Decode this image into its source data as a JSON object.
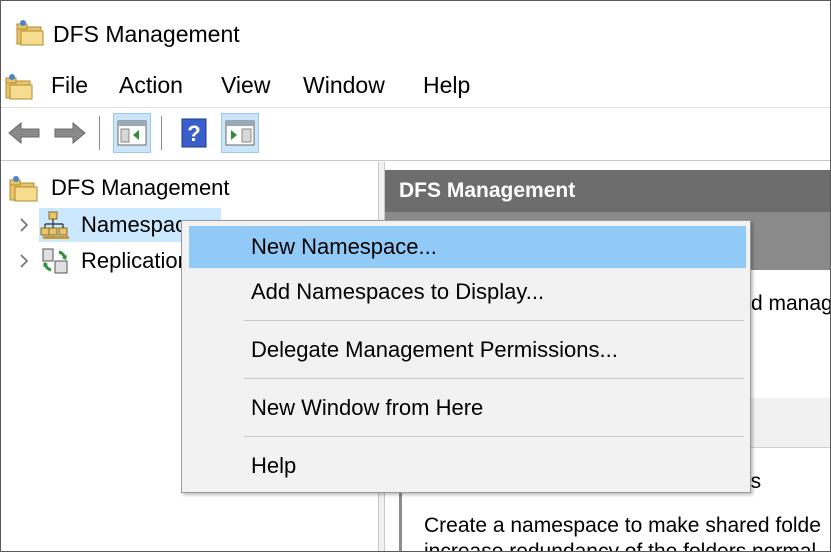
{
  "window": {
    "title": "DFS Management"
  },
  "menubar": {
    "items": [
      "File",
      "Action",
      "View",
      "Window",
      "Help"
    ]
  },
  "toolbar": {
    "buttons": [
      {
        "name": "back",
        "icon": "back-arrow-icon"
      },
      {
        "name": "forward",
        "icon": "forward-arrow-icon"
      },
      {
        "name": "show-hide-console-tree",
        "icon": "console-tree-icon",
        "pressed": true
      },
      {
        "name": "help",
        "icon": "help-icon",
        "label": "?"
      },
      {
        "name": "show-hide-action-pane",
        "icon": "action-pane-icon",
        "pressed": true
      }
    ]
  },
  "tree": {
    "root": {
      "label": "DFS Management",
      "icon": "dfs-management-icon"
    },
    "nodes": [
      {
        "label": "Namespaces",
        "icon": "namespaces-icon",
        "selected": true
      },
      {
        "label": "Replication",
        "icon": "replication-icon",
        "selected": false
      }
    ]
  },
  "right_pane": {
    "header": "DFS Management",
    "description_fragment": "d manag",
    "section_title_fragment": "ers",
    "body_line1": "Create a namespace to make shared folde",
    "body_line2": "increase redundancy of the folders normal"
  },
  "context_menu": {
    "items": [
      {
        "label": "New Namespace...",
        "highlighted": true
      },
      {
        "label": "Add Namespaces to Display...",
        "highlighted": false
      },
      {
        "label": "Delegate Management Permissions...",
        "highlighted": false
      },
      {
        "label": "New Window from Here",
        "highlighted": false
      },
      {
        "label": "Help",
        "highlighted": false
      }
    ]
  },
  "colors": {
    "menu_highlight": "#91c9f7",
    "pane_header": "#6d6d6d",
    "selection": "#cce8ff",
    "toolbar_pressed": "#cce4f7"
  }
}
